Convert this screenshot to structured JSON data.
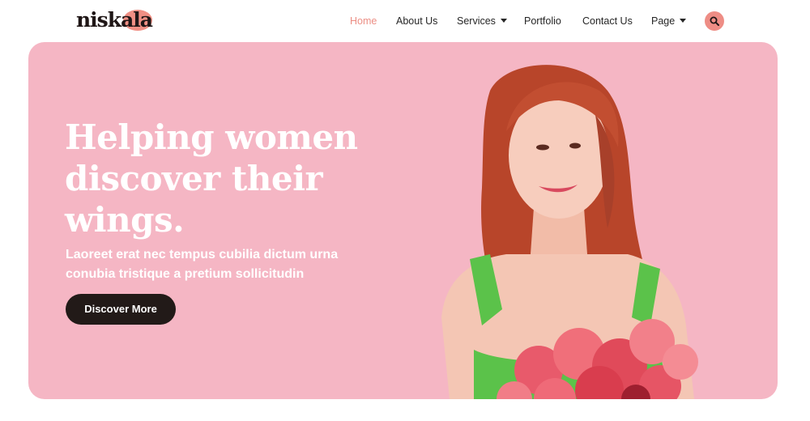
{
  "brand": {
    "logo_text": "niskala",
    "accent": "#ee8d85",
    "dark": "#221a18",
    "hero_bg": "#f5b6c4"
  },
  "nav": {
    "home": "Home",
    "about": "About Us",
    "services": "Services",
    "portfolio": "Portfolio",
    "contact": "Contact Us",
    "page": "Page",
    "search_icon": "search-icon"
  },
  "hero": {
    "title_line1": "Helping women",
    "title_line2": "discover their",
    "title_line3": "wings.",
    "subtitle_line1": "Laoreet erat nec tempus cubilia dictum urna",
    "subtitle_line2": "conubia tristique a pretium sollicitudin",
    "cta_label": "Discover More"
  }
}
